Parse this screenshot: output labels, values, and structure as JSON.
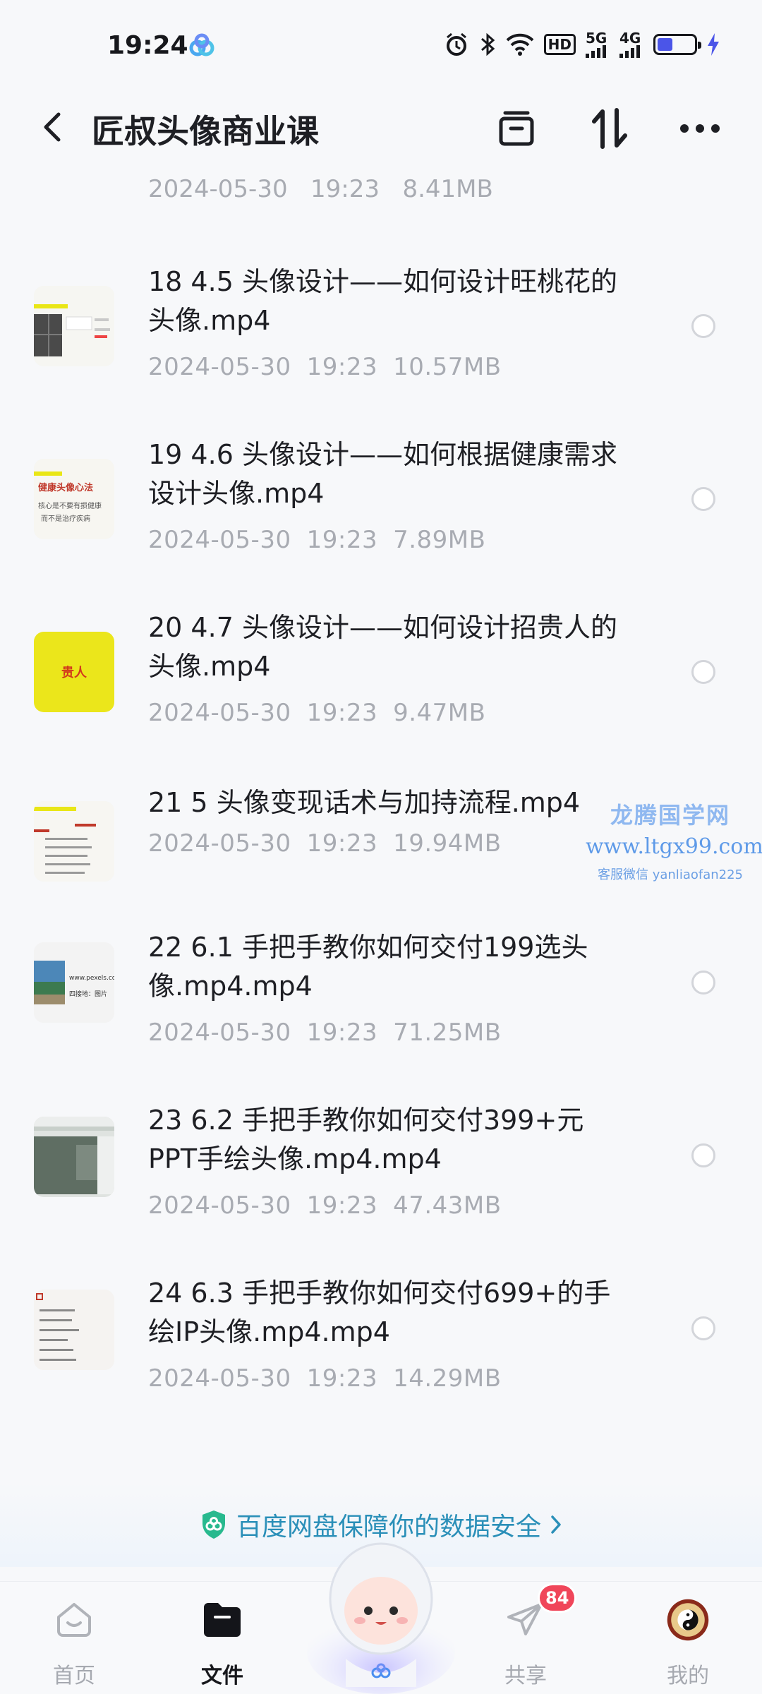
{
  "status_bar": {
    "time": "19:24",
    "network_1": "5G",
    "network_2": "4G",
    "hd_label": "HD",
    "battery_level": 0.42,
    "icons": [
      "alarm-icon",
      "bluetooth-icon",
      "wifi-icon",
      "hd-icon",
      "signal-icon",
      "battery-icon",
      "charging-icon"
    ]
  },
  "header": {
    "title": "匠叔头像商业课",
    "icons": [
      "back-icon",
      "multi-select-icon",
      "sort-icon",
      "more-icon"
    ]
  },
  "partial_item": {
    "date": "2024-05-30",
    "time": "19:23",
    "size": "8.41MB"
  },
  "files": [
    {
      "name_line1": "18 4.5 头像设计——如何设计旺桃花的",
      "name_line2": "头像.mp4",
      "date": "2024-05-30",
      "time": "19:23",
      "size": "10.57MB",
      "thumb": "video-thumb-18"
    },
    {
      "name_line1": "19 4.6 头像设计——如何根据健康需求",
      "name_line2": "设计头像.mp4",
      "date": "2024-05-30",
      "time": "19:23",
      "size": "7.89MB",
      "thumb": "video-thumb-19",
      "thumb_text": {
        "title": "健康头像心法",
        "line1": "核心是不要有损健康",
        "line2": "而不是治疗疾病"
      }
    },
    {
      "name_line1": "20 4.7 头像设计——如何设计招贵人的",
      "name_line2": "头像.mp4",
      "date": "2024-05-30",
      "time": "19:23",
      "size": "9.47MB",
      "thumb": "video-thumb-20",
      "thumb_text": {
        "title": "贵人"
      }
    },
    {
      "name_line1": "21 5 头像变现话术与加持流程.mp4",
      "name_line2": "",
      "date": "2024-05-30",
      "time": "19:23",
      "size": "19.94MB",
      "thumb": "video-thumb-21"
    },
    {
      "name_line1": "22 6.1 手把手教你如何交付199选头",
      "name_line2": "像.mp4.mp4",
      "date": "2024-05-30",
      "time": "19:23",
      "size": "71.25MB",
      "thumb": "video-thumb-22",
      "thumb_text": {
        "line1": "www.pexels.com",
        "line2": "四接地：图片"
      }
    },
    {
      "name_line1": "23 6.2 手把手教你如何交付399+元",
      "name_line2": "PPT手绘头像.mp4.mp4",
      "date": "2024-05-30",
      "time": "19:23",
      "size": "47.43MB",
      "thumb": "video-thumb-23"
    },
    {
      "name_line1": "24 6.3 手把手教你如何交付699+的手",
      "name_line2": "绘IP头像.mp4.mp4",
      "date": "2024-05-30",
      "time": "19:23",
      "size": "14.29MB",
      "thumb": "video-thumb-24"
    }
  ],
  "watermark": {
    "title": "龙腾国学网",
    "url": "www.ltgx99.com",
    "contact": "客服微信 yanliaofan225"
  },
  "security_banner": {
    "text": "百度网盘保障你的数据安全",
    "icon": "shield-icon"
  },
  "bottom_nav": {
    "items": [
      {
        "label": "首页",
        "icon": "home-icon",
        "active": false
      },
      {
        "label": "文件",
        "icon": "folder-icon",
        "active": true
      },
      {
        "label": "共享",
        "icon": "share-plane-icon",
        "active": false,
        "badge": "84"
      },
      {
        "label": "我的",
        "icon": "profile-avatar-icon",
        "active": false
      }
    ]
  },
  "colors": {
    "accent_blue": "#4b55e8",
    "security_teal": "#2a8fb8",
    "badge_red": "#f0465a",
    "meta_gray": "#a8abb2"
  }
}
